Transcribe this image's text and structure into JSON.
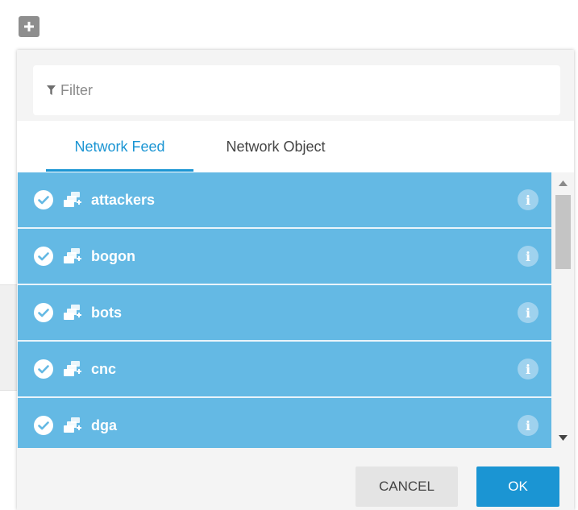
{
  "add_button": {
    "icon": "plus-icon"
  },
  "filter": {
    "placeholder": "Filter",
    "value": "",
    "icon": "filter-icon"
  },
  "tabs": [
    {
      "label": "Network Feed",
      "active": true
    },
    {
      "label": "Network Object",
      "active": false
    }
  ],
  "items": [
    {
      "label": "attackers",
      "selected": true,
      "icon": "network-feed-icon"
    },
    {
      "label": "bogon",
      "selected": true,
      "icon": "network-feed-icon"
    },
    {
      "label": "bots",
      "selected": true,
      "icon": "network-feed-icon"
    },
    {
      "label": "cnc",
      "selected": true,
      "icon": "network-feed-icon"
    },
    {
      "label": "dga",
      "selected": true,
      "icon": "network-feed-icon"
    }
  ],
  "footer": {
    "cancel_label": "CANCEL",
    "ok_label": "OK"
  },
  "colors": {
    "accent": "#1b95d3",
    "selected_row": "#64b9e4",
    "info_icon": "#9fd2ee",
    "popover_bg": "#f4f4f4"
  }
}
